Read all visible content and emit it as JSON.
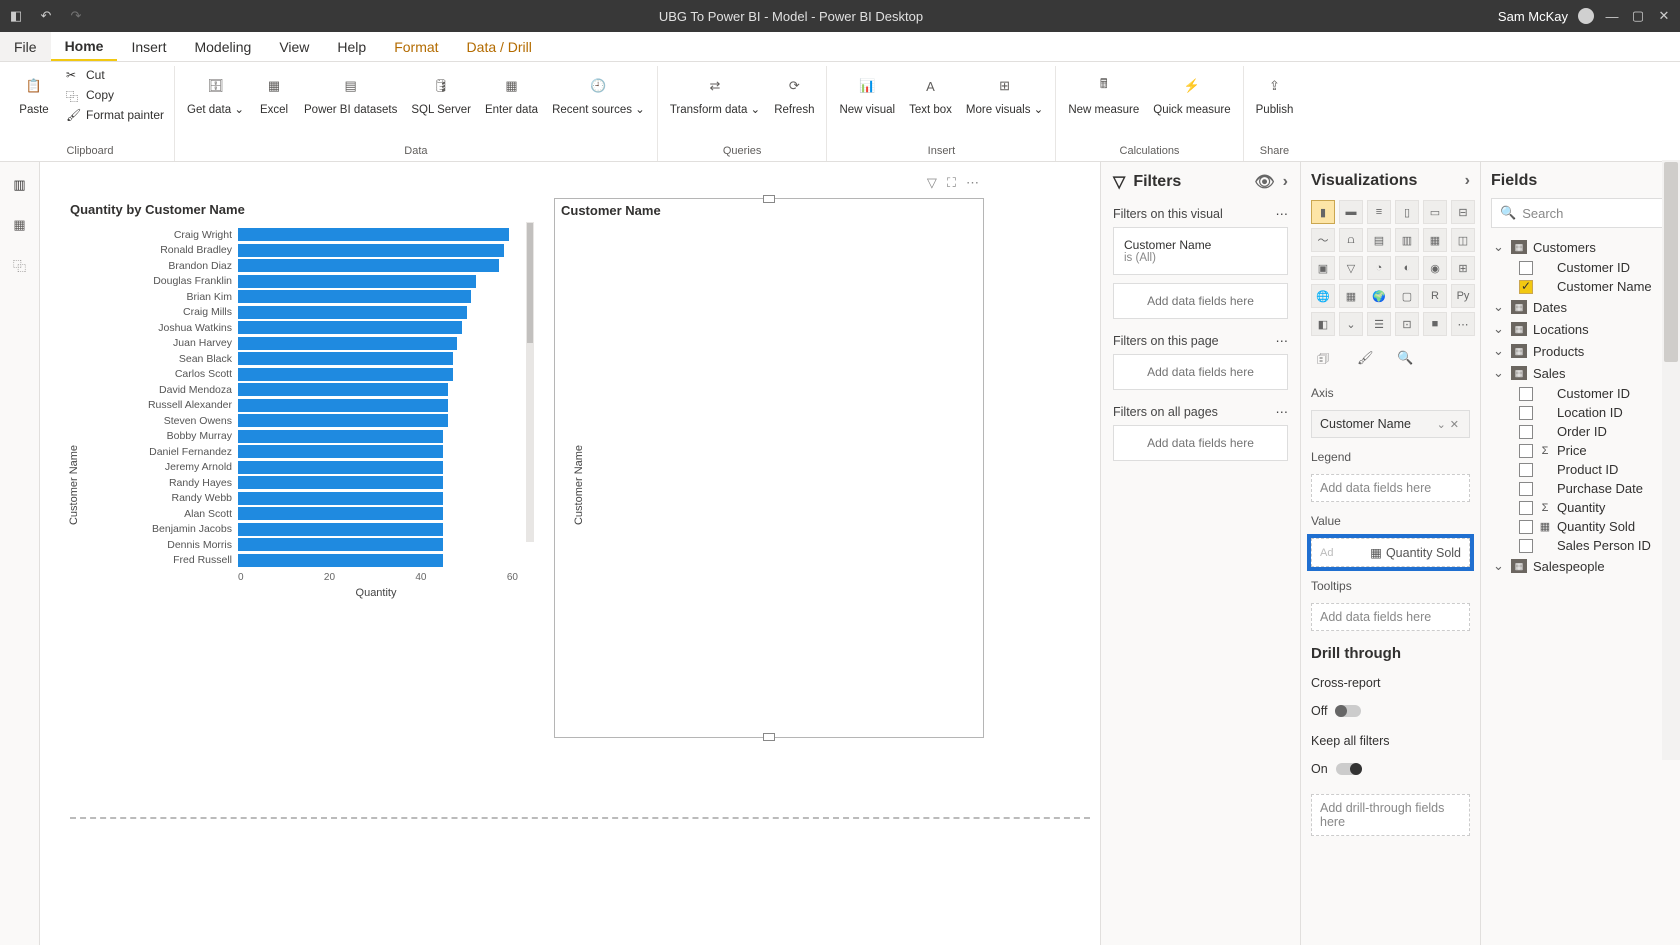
{
  "titlebar": {
    "title": "UBG To Power BI - Model - Power BI Desktop",
    "user": "Sam McKay"
  },
  "menu": {
    "tabs": [
      "File",
      "Home",
      "Insert",
      "Modeling",
      "View",
      "Help",
      "Format",
      "Data / Drill"
    ],
    "active": "Home"
  },
  "ribbon": {
    "clipboard": {
      "paste": "Paste",
      "cut": "Cut",
      "copy": "Copy",
      "format_painter": "Format painter",
      "group": "Clipboard"
    },
    "data": {
      "get_data": "Get data",
      "excel": "Excel",
      "pbi_datasets": "Power BI datasets",
      "sql": "SQL Server",
      "enter": "Enter data",
      "recent": "Recent sources",
      "group": "Data"
    },
    "queries": {
      "transform": "Transform data",
      "refresh": "Refresh",
      "group": "Queries"
    },
    "insert": {
      "new_visual": "New visual",
      "text_box": "Text box",
      "more": "More visuals",
      "group": "Insert"
    },
    "calc": {
      "new_measure": "New measure",
      "quick": "Quick measure",
      "group": "Calculations"
    },
    "share": {
      "publish": "Publish",
      "group": "Share"
    }
  },
  "leftrail": {
    "report": "report-view",
    "data": "data-view",
    "model": "model-view"
  },
  "chart_data": {
    "type": "bar",
    "orientation": "horizontal",
    "title": "Quantity by Customer Name",
    "xlabel": "Quantity",
    "ylabel": "Customer Name",
    "xlim": [
      0,
      60
    ],
    "xticks": [
      0,
      20,
      40,
      60
    ],
    "categories": [
      "Craig Wright",
      "Ronald Bradley",
      "Brandon Diaz",
      "Douglas Franklin",
      "Brian Kim",
      "Craig Mills",
      "Joshua Watkins",
      "Juan Harvey",
      "Sean Black",
      "Carlos Scott",
      "David Mendoza",
      "Russell Alexander",
      "Steven Owens",
      "Bobby Murray",
      "Daniel Fernandez",
      "Jeremy Arnold",
      "Randy Hayes",
      "Randy Webb",
      "Alan Scott",
      "Benjamin Jacobs",
      "Dennis Morris",
      "Fred Russell"
    ],
    "values": [
      58,
      57,
      56,
      51,
      50,
      49,
      48,
      47,
      46,
      46,
      45,
      45,
      45,
      44,
      44,
      44,
      44,
      44,
      44,
      44,
      44,
      44
    ]
  },
  "visual2": {
    "title": "Customer Name",
    "ylabel": "Customer Name"
  },
  "filters": {
    "title": "Filters",
    "on_visual": "Filters on this visual",
    "card": {
      "field": "Customer Name",
      "state": "is (All)"
    },
    "add": "Add data fields here",
    "on_page": "Filters on this page",
    "on_all": "Filters on all pages"
  },
  "viz": {
    "title": "Visualizations",
    "wells": {
      "axis": "Axis",
      "axis_val": "Customer Name",
      "legend": "Legend",
      "value": "Value",
      "value_drag": "Quantity Sold",
      "tooltips": "Tooltips",
      "add": "Add data fields here"
    },
    "drill": {
      "title": "Drill through",
      "cross": "Cross-report",
      "cross_state": "Off",
      "keep": "Keep all filters",
      "keep_state": "On",
      "add": "Add drill-through fields here"
    }
  },
  "fields": {
    "title": "Fields",
    "search": "Search",
    "tables": [
      {
        "name": "Customers",
        "open": true,
        "fields": [
          {
            "n": "Customer ID"
          },
          {
            "n": "Customer Name",
            "checked": true
          }
        ]
      },
      {
        "name": "Dates",
        "open": false
      },
      {
        "name": "Locations",
        "open": false
      },
      {
        "name": "Products",
        "open": false
      },
      {
        "name": "Sales",
        "open": true,
        "fields": [
          {
            "n": "Customer ID"
          },
          {
            "n": "Location ID"
          },
          {
            "n": "Order ID"
          },
          {
            "n": "Price",
            "sig": "Σ"
          },
          {
            "n": "Product ID"
          },
          {
            "n": "Purchase Date"
          },
          {
            "n": "Quantity",
            "sig": "Σ"
          },
          {
            "n": "Quantity Sold",
            "sig": "▦"
          },
          {
            "n": "Sales Person ID"
          }
        ]
      },
      {
        "name": "Salespeople",
        "open": false
      }
    ]
  }
}
